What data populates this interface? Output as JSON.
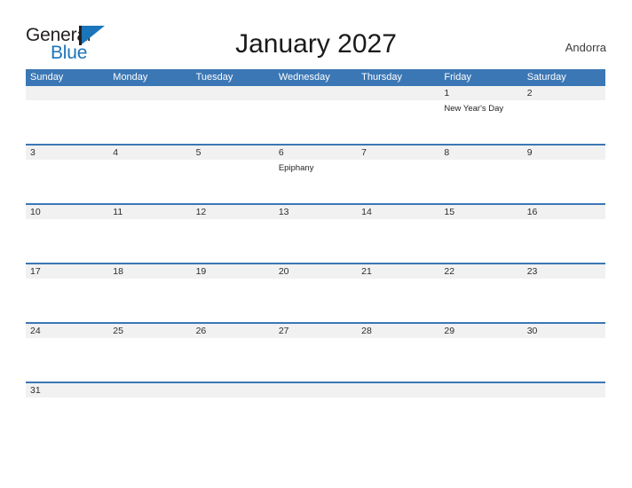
{
  "branding": {
    "logo_primary": "General",
    "logo_secondary": "Blue",
    "logo_mark_name": "blue-flag-triangle",
    "accent_color": "#1b75bb"
  },
  "header": {
    "title": "January 2027",
    "country": "Andorra"
  },
  "colors": {
    "header_blue": "#3b77b5",
    "rule_blue": "#3b77b5",
    "day_band_gray": "#f1f1f1",
    "title_text": "#1a1a1a"
  },
  "calendar": {
    "weekdays": [
      "Sunday",
      "Monday",
      "Tuesday",
      "Wednesday",
      "Thursday",
      "Friday",
      "Saturday"
    ],
    "weeks": [
      {
        "short": false,
        "days": [
          {
            "number": "",
            "events": []
          },
          {
            "number": "",
            "events": []
          },
          {
            "number": "",
            "events": []
          },
          {
            "number": "",
            "events": []
          },
          {
            "number": "",
            "events": []
          },
          {
            "number": "1",
            "events": [
              "New Year's Day"
            ]
          },
          {
            "number": "2",
            "events": []
          }
        ]
      },
      {
        "short": false,
        "days": [
          {
            "number": "3",
            "events": []
          },
          {
            "number": "4",
            "events": []
          },
          {
            "number": "5",
            "events": []
          },
          {
            "number": "6",
            "events": [
              "Epiphany"
            ]
          },
          {
            "number": "7",
            "events": []
          },
          {
            "number": "8",
            "events": []
          },
          {
            "number": "9",
            "events": []
          }
        ]
      },
      {
        "short": false,
        "days": [
          {
            "number": "10",
            "events": []
          },
          {
            "number": "11",
            "events": []
          },
          {
            "number": "12",
            "events": []
          },
          {
            "number": "13",
            "events": []
          },
          {
            "number": "14",
            "events": []
          },
          {
            "number": "15",
            "events": []
          },
          {
            "number": "16",
            "events": []
          }
        ]
      },
      {
        "short": false,
        "days": [
          {
            "number": "17",
            "events": []
          },
          {
            "number": "18",
            "events": []
          },
          {
            "number": "19",
            "events": []
          },
          {
            "number": "20",
            "events": []
          },
          {
            "number": "21",
            "events": []
          },
          {
            "number": "22",
            "events": []
          },
          {
            "number": "23",
            "events": []
          }
        ]
      },
      {
        "short": false,
        "days": [
          {
            "number": "24",
            "events": []
          },
          {
            "number": "25",
            "events": []
          },
          {
            "number": "26",
            "events": []
          },
          {
            "number": "27",
            "events": []
          },
          {
            "number": "28",
            "events": []
          },
          {
            "number": "29",
            "events": []
          },
          {
            "number": "30",
            "events": []
          }
        ]
      },
      {
        "short": true,
        "days": [
          {
            "number": "31",
            "events": []
          },
          {
            "number": "",
            "events": []
          },
          {
            "number": "",
            "events": []
          },
          {
            "number": "",
            "events": []
          },
          {
            "number": "",
            "events": []
          },
          {
            "number": "",
            "events": []
          },
          {
            "number": "",
            "events": []
          }
        ]
      }
    ]
  }
}
